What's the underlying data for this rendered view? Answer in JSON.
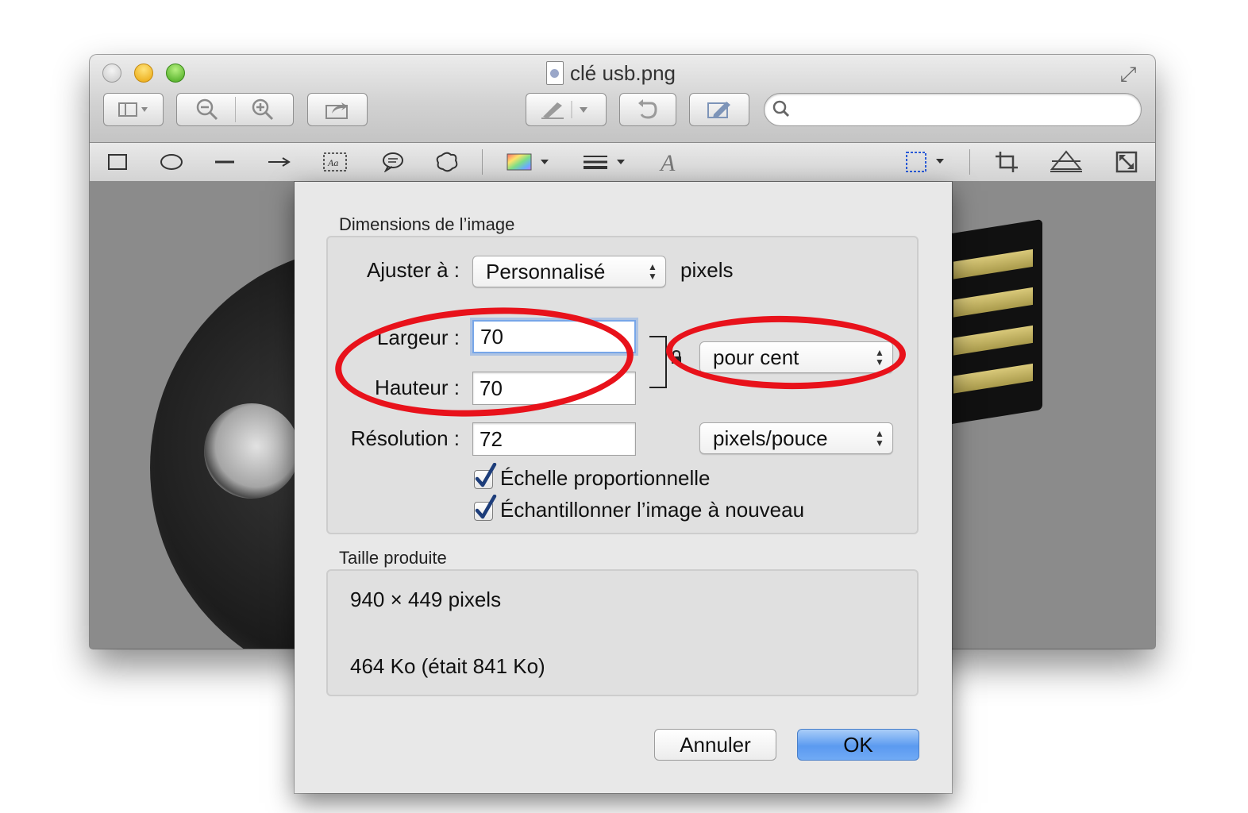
{
  "window": {
    "title": "clé usb.png"
  },
  "toolbar": {
    "sidebar_icon": "sidebar-view-icon",
    "zoom_out_icon": "zoom-out-icon",
    "zoom_in_icon": "zoom-in-icon",
    "share_icon": "share-icon",
    "markup_icon": "pen-icon",
    "rotate_icon": "rotate-icon",
    "edit_icon": "edit-toolbar-icon",
    "search_placeholder": ""
  },
  "annotation_tools": [
    "rectangle-icon",
    "oval-icon",
    "line-icon",
    "arrow-icon",
    "text-box-icon",
    "speech-bubble-icon",
    "shape-icon",
    "color-icon",
    "line-style-icon",
    "font-icon",
    "selection-icon",
    "crop-icon",
    "adjust-color-icon",
    "resize-icon"
  ],
  "dialog": {
    "dimensions_title": "Dimensions de l’image",
    "fit_label": "Ajuster à :",
    "fit_value": "Personnalisé",
    "fit_unit": "pixels",
    "width_label": "Largeur :",
    "width_value": "70",
    "height_label": "Hauteur :",
    "height_value": "70",
    "size_unit": "pour cent",
    "resolution_label": "Résolution :",
    "resolution_value": "72",
    "resolution_unit": "pixels/pouce",
    "scale_proportionally": "Échelle proportionnelle",
    "scale_checked": true,
    "resample": "Échantillonner l’image à nouveau",
    "resample_checked": true,
    "result_title": "Taille produite",
    "result_dimensions": "940 × 449 pixels",
    "result_size": "464 Ko (était 841 Ko)",
    "cancel_label": "Annuler",
    "ok_label": "OK"
  },
  "colors": {
    "annotation_red": "#e8121b",
    "ok_button_blue": "#5b9af0"
  }
}
